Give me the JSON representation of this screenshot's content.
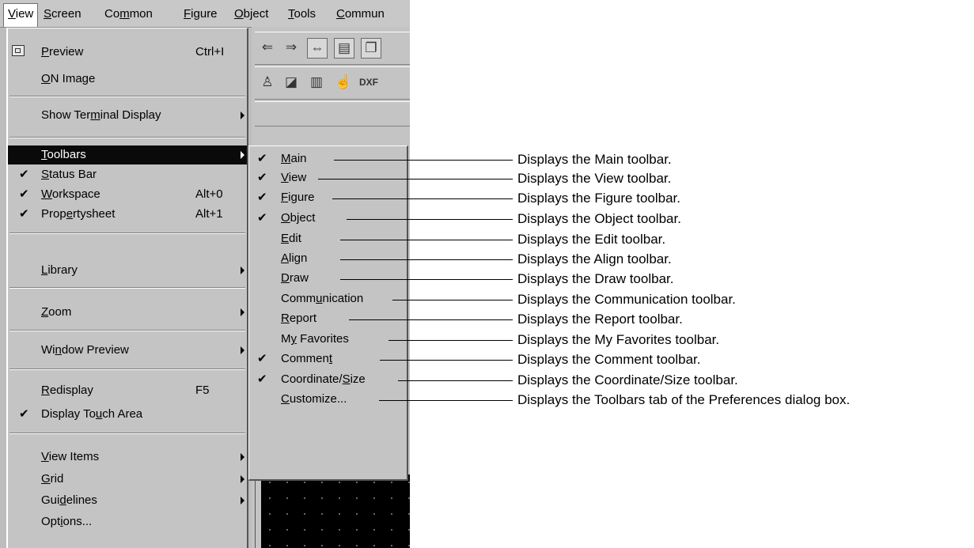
{
  "menubar": {
    "items": [
      {
        "label": "View",
        "u": "V",
        "rest": "iew"
      },
      {
        "label": "Screen",
        "u": "S",
        "rest": "creen"
      },
      {
        "label": "Common",
        "pre": "Co",
        "u": "m",
        "rest": "mon"
      },
      {
        "label": "Figure",
        "u": "F",
        "rest": "igure"
      },
      {
        "label": "Object",
        "u": "O",
        "rest": "bject"
      },
      {
        "label": "Tools",
        "u": "T",
        "rest": "ools"
      },
      {
        "label": "Commun",
        "u": "C",
        "rest": "ommun"
      }
    ]
  },
  "view_menu": {
    "preview": {
      "pre": "",
      "u": "P",
      "rest": "review",
      "shortcut": "Ctrl+I"
    },
    "on_image": {
      "pre": "",
      "u": "O",
      "rest": "N Image"
    },
    "show_terminal": {
      "pre": "Show Ter",
      "u": "m",
      "rest": "inal Display"
    },
    "toolbars": {
      "pre": "",
      "u": "T",
      "rest": "oolbars"
    },
    "status_bar": {
      "pre": "",
      "u": "S",
      "rest": "tatus Bar"
    },
    "workspace": {
      "pre": "",
      "u": "W",
      "rest": "orkspace",
      "shortcut": "Alt+0"
    },
    "propertysheet": {
      "pre": "Prop",
      "u": "e",
      "rest": "rtysheet",
      "shortcut": "Alt+1"
    },
    "library": {
      "pre": "",
      "u": "L",
      "rest": "ibrary"
    },
    "zoom": {
      "pre": "",
      "u": "Z",
      "rest": "oom"
    },
    "window_preview": {
      "pre": "Wi",
      "u": "n",
      "rest": "dow Preview"
    },
    "redisplay": {
      "pre": "",
      "u": "R",
      "rest": "edisplay",
      "shortcut": "F5"
    },
    "display_touch": {
      "pre": "Display To",
      "u": "u",
      "rest": "ch Area"
    },
    "view_items": {
      "pre": "",
      "u": "V",
      "rest": "iew Items"
    },
    "grid": {
      "pre": "",
      "u": "G",
      "rest": "rid"
    },
    "guidelines": {
      "pre": "Gui",
      "u": "d",
      "rest": "elines"
    },
    "options": {
      "pre": "Opt",
      "u": "i",
      "rest": "ons..."
    }
  },
  "toolbars_submenu": [
    {
      "pre": "",
      "u": "M",
      "rest": "ain",
      "checked": true,
      "desc": "Displays the Main toolbar."
    },
    {
      "pre": "",
      "u": "V",
      "rest": "iew",
      "checked": true,
      "desc": "Displays the View toolbar."
    },
    {
      "pre": "",
      "u": "F",
      "rest": "igure",
      "checked": true,
      "desc": "Displays the Figure toolbar."
    },
    {
      "pre": "",
      "u": "O",
      "rest": "bject",
      "checked": true,
      "desc": "Displays the Object toolbar."
    },
    {
      "pre": "",
      "u": "E",
      "rest": "dit",
      "checked": false,
      "desc": "Displays the Edit toolbar."
    },
    {
      "pre": "",
      "u": "A",
      "rest": "lign",
      "checked": false,
      "desc": "Displays the Align toolbar."
    },
    {
      "pre": "",
      "u": "D",
      "rest": "raw",
      "checked": false,
      "desc": "Displays the Draw toolbar."
    },
    {
      "pre": "Comm",
      "u": "u",
      "rest": "nication",
      "checked": false,
      "desc": "Displays the Communication toolbar."
    },
    {
      "pre": "",
      "u": "R",
      "rest": "eport",
      "checked": false,
      "desc": "Displays the Report toolbar."
    },
    {
      "pre": "M",
      "u": "y",
      "rest": " Favorites",
      "checked": false,
      "desc": "Displays the My Favorites toolbar."
    },
    {
      "pre": "Commen",
      "u": "t",
      "rest": "",
      "checked": true,
      "desc": "Displays the Comment toolbar."
    },
    {
      "pre": "Coordinate/",
      "u": "S",
      "rest": "ize",
      "checked": true,
      "desc": "Displays the Coordinate/Size toolbar."
    },
    {
      "pre": "",
      "u": "C",
      "rest": "ustomize...",
      "checked": false,
      "desc": "Displays the Toolbars tab of the Preferences dialog box."
    }
  ],
  "toolbar_icons": {
    "row1": [
      "back-arrow",
      "forward-arrow",
      "arrange",
      "list-view",
      "layers"
    ],
    "row2": [
      "paint",
      "image",
      "monitor",
      "hand",
      "dxf"
    ],
    "dxf_label": "DXF",
    "row3_label": "ꟷ ꟷ ꟷ"
  }
}
